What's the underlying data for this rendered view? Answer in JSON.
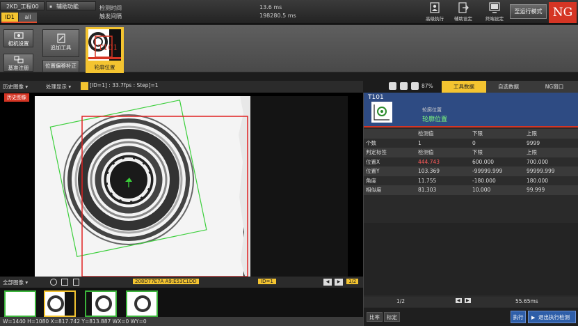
{
  "topbar": {
    "project": "2KD_工程00",
    "aux_menu": "辅助功能",
    "tab_id1": "ID1",
    "tab_all": "all",
    "detect_time_label": "检测时间",
    "trigger_interval_label": "触发间隔",
    "detect_time_value": "13.6 ms",
    "trigger_interval_value": "198280.5 ms",
    "buttons": [
      {
        "label": "高级执行",
        "icon": "person-gear-icon"
      },
      {
        "label": "辅助设定",
        "icon": "export-icon"
      },
      {
        "label": "终端设定",
        "icon": "monitor-icon"
      }
    ],
    "run_mode": "至运行模式",
    "ng": "NG"
  },
  "toolbar": {
    "camera_setup": "相机设置",
    "reference_reg": "基准注册",
    "add_tool": "追加工具",
    "pos_offset": "位置偏移补正",
    "tool_card_label": "轮廓位置",
    "tool_card_id": "T101"
  },
  "imgbar": {
    "history_image": "历史图像",
    "process_display": "处理显示",
    "info": "[ID=1] : 33.7fps : Step]=1",
    "zoom": "87%"
  },
  "rtabs": {
    "tool_data": "工具数据",
    "custom_data": "自选数据",
    "ng_window": "NG窗口"
  },
  "image": {
    "history_tag": "历史图像",
    "all_images": "全部图像",
    "hexcode": "208D77E7A A9:E53C1DD",
    "id_label": "ID=1",
    "page": "1/2",
    "status": "W=1440 H=1080 X=817.742 Y=813.887 WX=0 WY=0"
  },
  "rpanel": {
    "title": "T101",
    "category": "轮廓位置",
    "name": "轮廓位置",
    "table": [
      [
        "",
        "检测值",
        "下限",
        "上限"
      ],
      [
        "个数",
        "1",
        "0",
        "9999"
      ],
      [
        "判定标签",
        "检测值",
        "下限",
        "上限"
      ],
      [
        "位置X",
        "444.743",
        "600.000",
        "700.000"
      ],
      [
        "位置Y",
        "103.369",
        "-99999.999",
        "99999.999"
      ],
      [
        "角度",
        "11.755",
        "-180.000",
        "180.000"
      ],
      [
        "相似度",
        "81.303",
        "10.000",
        "99.999"
      ]
    ],
    "page": "1/2",
    "elapsed": "55.65ms",
    "compare_btn": "比率",
    "calib_btn": "标定",
    "exec_btn": "执行",
    "stop_btn": "退出执行检测"
  },
  "colors": {
    "accent_yellow": "#f4c430",
    "ng_red": "#d53524",
    "panel_blue": "#2e4b83",
    "ok_green": "#3bb43b"
  }
}
